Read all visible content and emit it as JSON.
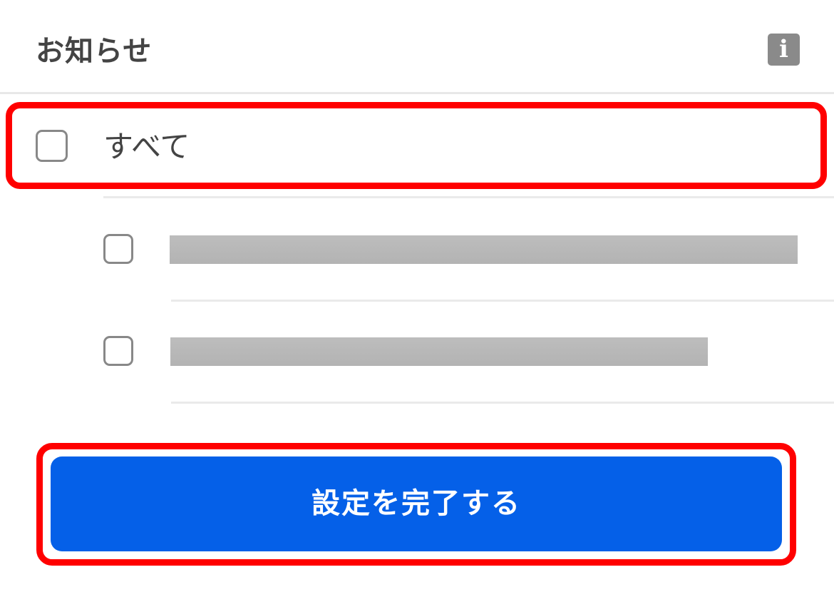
{
  "header": {
    "title": "お知らせ",
    "info_icon": "info-icon",
    "info_glyph": "i"
  },
  "options": {
    "all_label": "すべて",
    "all_checked": false,
    "sub_items": [
      {
        "label_redacted": true,
        "checked": false
      },
      {
        "label_redacted": true,
        "checked": false
      }
    ]
  },
  "footer": {
    "complete_label": "設定を完了する"
  },
  "colors": {
    "accent": "#0560e8",
    "highlight": "#ff0000",
    "info_bg": "#8a8a8a",
    "text": "#444444"
  }
}
